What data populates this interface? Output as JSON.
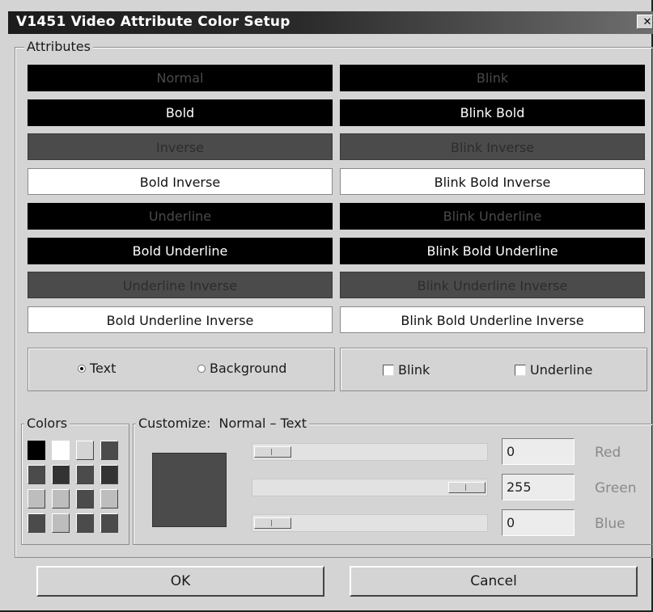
{
  "window": {
    "title": "V1451 Video Attribute Color Setup",
    "close_glyph": "✕"
  },
  "attributes": {
    "legend": "Attributes",
    "items": [
      {
        "label": "Normal"
      },
      {
        "label": "Blink"
      },
      {
        "label": "Bold"
      },
      {
        "label": "Blink Bold"
      },
      {
        "label": "Inverse"
      },
      {
        "label": "Blink Inverse"
      },
      {
        "label": "Bold Inverse"
      },
      {
        "label": "Blink Bold Inverse"
      },
      {
        "label": "Underline"
      },
      {
        "label": "Blink Underline"
      },
      {
        "label": "Bold Underline"
      },
      {
        "label": "Blink Bold Underline"
      },
      {
        "label": "Underline Inverse"
      },
      {
        "label": "Blink Underline Inverse"
      },
      {
        "label": "Bold Underline Inverse"
      },
      {
        "label": "Blink Bold Underline Inverse"
      }
    ]
  },
  "options": {
    "text_label": "Text",
    "text_selected": true,
    "background_label": "Background",
    "background_selected": false,
    "blink_label": "Blink",
    "blink_checked": false,
    "underline_label": "Underline",
    "underline_checked": false
  },
  "colors": {
    "legend": "Colors",
    "palette": [
      "#000000",
      "#ffffff",
      "#d4d4d4",
      "#4b4b4b",
      "#4b4b4b",
      "#333333",
      "#4b4b4b",
      "#333333",
      "#bdbdbd",
      "#bdbdbd",
      "#4b4b4b",
      "#bdbdbd",
      "#4b4b4b",
      "#bdbdbd",
      "#4b4b4b",
      "#4b4b4b"
    ]
  },
  "customize": {
    "legend": "Customize:",
    "target": "Normal – Text",
    "preview_color": "#4b4b4b",
    "channels": [
      {
        "name": "Red",
        "value": "0",
        "fraction": 0.0
      },
      {
        "name": "Green",
        "value": "255",
        "fraction": 1.0
      },
      {
        "name": "Blue",
        "value": "0",
        "fraction": 0.0
      }
    ]
  },
  "buttons": {
    "ok": "OK",
    "cancel": "Cancel"
  }
}
